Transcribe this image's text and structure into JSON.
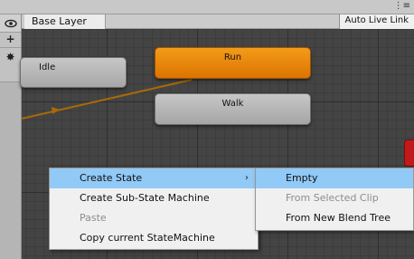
{
  "layer_bar": {
    "layer_name": "Base Layer",
    "auto_live_link_label": "Auto Live Link"
  },
  "toolbar_icons": [
    "eye-icon",
    "plus-icon",
    "gear-icon",
    "menu-icon"
  ],
  "states": [
    {
      "name": "Idle",
      "default": false
    },
    {
      "name": "Run",
      "default": true
    },
    {
      "name": "Walk",
      "default": false
    }
  ],
  "colors": {
    "default_state": "#ee8a10",
    "state": "#b6b6b6",
    "transition": "#a86a06",
    "menu_highlight": "#91c9f7"
  },
  "context_menu": {
    "items": [
      {
        "label": "Create State",
        "has_submenu": true,
        "highlighted": true,
        "enabled": true
      },
      {
        "label": "Create Sub-State Machine",
        "has_submenu": false,
        "highlighted": false,
        "enabled": true
      },
      {
        "label": "Paste",
        "has_submenu": false,
        "highlighted": false,
        "enabled": false
      },
      {
        "label": "Copy current StateMachine",
        "has_submenu": false,
        "highlighted": false,
        "enabled": true
      }
    ],
    "submenu_arrow": "›"
  },
  "submenu": {
    "items": [
      {
        "label": "Empty",
        "highlighted": true,
        "enabled": true
      },
      {
        "label": "From Selected Clip",
        "highlighted": false,
        "enabled": false
      },
      {
        "label": "From New Blend Tree",
        "highlighted": false,
        "enabled": true
      }
    ]
  }
}
